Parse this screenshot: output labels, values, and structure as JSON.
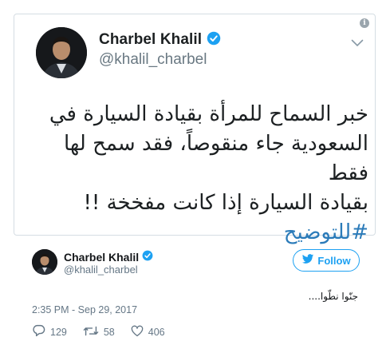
{
  "embedded": {
    "name": "Charbel Khalil",
    "handle": "@khalil_charbel",
    "text_lines": [
      "خبر السماح للمرأة بقيادة السيارة في",
      "السعودية جاء منقوصاً، فقد سمح لها فقط",
      "بقيادة السيارة إذا كانت مفخخة !!"
    ],
    "hashtag": "#للتوضيح"
  },
  "tweet": {
    "name": "Charbel Khalil",
    "handle": "@khalil_charbel",
    "follow_label": "Follow",
    "text": "جنّوا نطّوا....",
    "timestamp": "2:35 PM - Sep 29, 2017",
    "replies": "129",
    "retweets": "58",
    "likes": "406"
  },
  "colors": {
    "accent": "#1da1f2",
    "hashtag": "#2b7bb9",
    "muted": "#657786"
  },
  "icons": [
    "info-icon",
    "verified-icon",
    "chevron-down-icon",
    "follow-bird-icon",
    "reply-icon",
    "retweet-icon",
    "like-icon"
  ]
}
